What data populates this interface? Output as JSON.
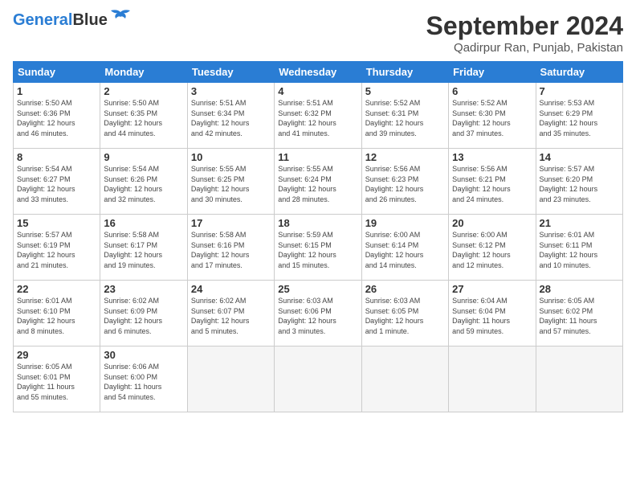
{
  "logo": {
    "part1": "General",
    "part2": "Blue"
  },
  "title": "September 2024",
  "subtitle": "Qadirpur Ran, Punjab, Pakistan",
  "days_of_week": [
    "Sunday",
    "Monday",
    "Tuesday",
    "Wednesday",
    "Thursday",
    "Friday",
    "Saturday"
  ],
  "weeks": [
    [
      {
        "day": "1",
        "info": "Sunrise: 5:50 AM\nSunset: 6:36 PM\nDaylight: 12 hours\nand 46 minutes."
      },
      {
        "day": "2",
        "info": "Sunrise: 5:50 AM\nSunset: 6:35 PM\nDaylight: 12 hours\nand 44 minutes."
      },
      {
        "day": "3",
        "info": "Sunrise: 5:51 AM\nSunset: 6:34 PM\nDaylight: 12 hours\nand 42 minutes."
      },
      {
        "day": "4",
        "info": "Sunrise: 5:51 AM\nSunset: 6:32 PM\nDaylight: 12 hours\nand 41 minutes."
      },
      {
        "day": "5",
        "info": "Sunrise: 5:52 AM\nSunset: 6:31 PM\nDaylight: 12 hours\nand 39 minutes."
      },
      {
        "day": "6",
        "info": "Sunrise: 5:52 AM\nSunset: 6:30 PM\nDaylight: 12 hours\nand 37 minutes."
      },
      {
        "day": "7",
        "info": "Sunrise: 5:53 AM\nSunset: 6:29 PM\nDaylight: 12 hours\nand 35 minutes."
      }
    ],
    [
      {
        "day": "8",
        "info": "Sunrise: 5:54 AM\nSunset: 6:27 PM\nDaylight: 12 hours\nand 33 minutes."
      },
      {
        "day": "9",
        "info": "Sunrise: 5:54 AM\nSunset: 6:26 PM\nDaylight: 12 hours\nand 32 minutes."
      },
      {
        "day": "10",
        "info": "Sunrise: 5:55 AM\nSunset: 6:25 PM\nDaylight: 12 hours\nand 30 minutes."
      },
      {
        "day": "11",
        "info": "Sunrise: 5:55 AM\nSunset: 6:24 PM\nDaylight: 12 hours\nand 28 minutes."
      },
      {
        "day": "12",
        "info": "Sunrise: 5:56 AM\nSunset: 6:23 PM\nDaylight: 12 hours\nand 26 minutes."
      },
      {
        "day": "13",
        "info": "Sunrise: 5:56 AM\nSunset: 6:21 PM\nDaylight: 12 hours\nand 24 minutes."
      },
      {
        "day": "14",
        "info": "Sunrise: 5:57 AM\nSunset: 6:20 PM\nDaylight: 12 hours\nand 23 minutes."
      }
    ],
    [
      {
        "day": "15",
        "info": "Sunrise: 5:57 AM\nSunset: 6:19 PM\nDaylight: 12 hours\nand 21 minutes."
      },
      {
        "day": "16",
        "info": "Sunrise: 5:58 AM\nSunset: 6:17 PM\nDaylight: 12 hours\nand 19 minutes."
      },
      {
        "day": "17",
        "info": "Sunrise: 5:58 AM\nSunset: 6:16 PM\nDaylight: 12 hours\nand 17 minutes."
      },
      {
        "day": "18",
        "info": "Sunrise: 5:59 AM\nSunset: 6:15 PM\nDaylight: 12 hours\nand 15 minutes."
      },
      {
        "day": "19",
        "info": "Sunrise: 6:00 AM\nSunset: 6:14 PM\nDaylight: 12 hours\nand 14 minutes."
      },
      {
        "day": "20",
        "info": "Sunrise: 6:00 AM\nSunset: 6:12 PM\nDaylight: 12 hours\nand 12 minutes."
      },
      {
        "day": "21",
        "info": "Sunrise: 6:01 AM\nSunset: 6:11 PM\nDaylight: 12 hours\nand 10 minutes."
      }
    ],
    [
      {
        "day": "22",
        "info": "Sunrise: 6:01 AM\nSunset: 6:10 PM\nDaylight: 12 hours\nand 8 minutes."
      },
      {
        "day": "23",
        "info": "Sunrise: 6:02 AM\nSunset: 6:09 PM\nDaylight: 12 hours\nand 6 minutes."
      },
      {
        "day": "24",
        "info": "Sunrise: 6:02 AM\nSunset: 6:07 PM\nDaylight: 12 hours\nand 5 minutes."
      },
      {
        "day": "25",
        "info": "Sunrise: 6:03 AM\nSunset: 6:06 PM\nDaylight: 12 hours\nand 3 minutes."
      },
      {
        "day": "26",
        "info": "Sunrise: 6:03 AM\nSunset: 6:05 PM\nDaylight: 12 hours\nand 1 minute."
      },
      {
        "day": "27",
        "info": "Sunrise: 6:04 AM\nSunset: 6:04 PM\nDaylight: 11 hours\nand 59 minutes."
      },
      {
        "day": "28",
        "info": "Sunrise: 6:05 AM\nSunset: 6:02 PM\nDaylight: 11 hours\nand 57 minutes."
      }
    ],
    [
      {
        "day": "29",
        "info": "Sunrise: 6:05 AM\nSunset: 6:01 PM\nDaylight: 11 hours\nand 55 minutes."
      },
      {
        "day": "30",
        "info": "Sunrise: 6:06 AM\nSunset: 6:00 PM\nDaylight: 11 hours\nand 54 minutes."
      },
      {
        "day": "",
        "info": ""
      },
      {
        "day": "",
        "info": ""
      },
      {
        "day": "",
        "info": ""
      },
      {
        "day": "",
        "info": ""
      },
      {
        "day": "",
        "info": ""
      }
    ]
  ]
}
